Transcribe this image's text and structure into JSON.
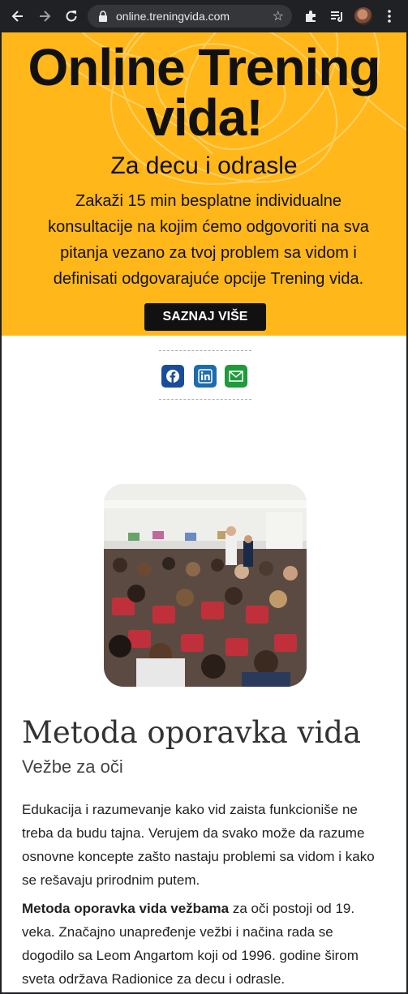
{
  "browser": {
    "url": "online.treningvida.com",
    "icons": [
      "back-arrow-icon",
      "forward-arrow-icon",
      "reload-icon",
      "lock-icon",
      "star-icon",
      "extensions-icon",
      "media-icon",
      "avatar",
      "menu-icon"
    ]
  },
  "hero": {
    "title_line1": "Online Trening",
    "title_line2": "vida!",
    "subtitle": "Za decu i odrasle",
    "body": "Zakaži 15 min besplatne individualne konsultacije na kojim ćemo odgovoriti na sva pitanja vezano za tvoj problem sa vidom i definisati odgovarajuće opcije Trening vida.",
    "cta_label": "SAZNAJ VIŠE",
    "colors": {
      "background": "#ffb71a",
      "button": "#111111"
    }
  },
  "share": {
    "icons": [
      {
        "name": "facebook-icon",
        "color": "#1a4c9c"
      },
      {
        "name": "linkedin-icon",
        "color": "#1c6dad"
      },
      {
        "name": "email-icon",
        "color": "#1e9b3a"
      }
    ]
  },
  "section": {
    "heading": "Metoda oporavka vida",
    "subheading": "Vežbe za oči",
    "para1": "Edukacija i razumevanje kako vid zaista funkcioniše ne treba da budu tajna. Verujem da svako može da razume osnovne koncepte zašto nastaju problemi sa vidom i kako se rešavaju prirodnim putem.",
    "para2_bold": "Metoda oporavka vida vežbama",
    "para2_rest": " za oči postoji od 19. veka. Značajno unapređenje vežbi i načina rada se dogodilo sa Leom Angartom koji od 1996. godine širom sveta održava Radionice za decu i odrasle."
  }
}
